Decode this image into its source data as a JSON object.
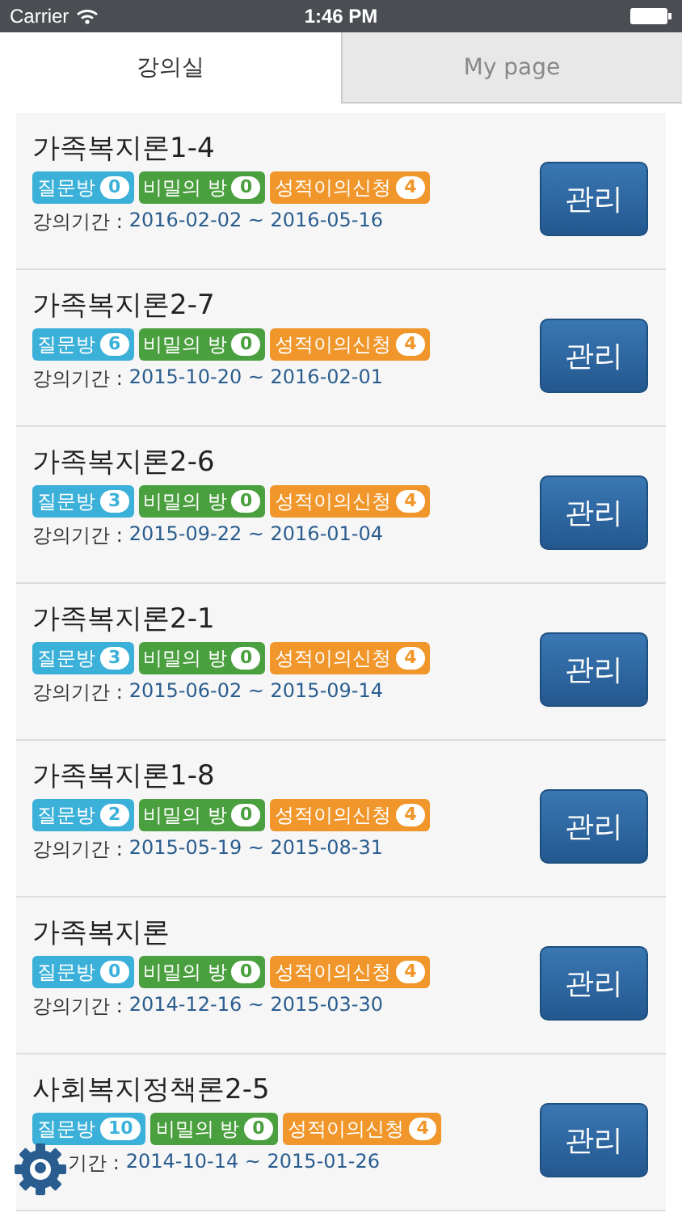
{
  "status_bar": {
    "carrier": "Carrier",
    "time": "1:46 PM"
  },
  "tabs": [
    {
      "label": "강의실",
      "selected": true
    },
    {
      "label": "My page",
      "selected": false
    }
  ],
  "courses": [
    {
      "title": "가족복지론1-4",
      "badges": [
        {
          "label": "질문방",
          "count": "0",
          "color": "#3bb0d9"
        },
        {
          "label": "비밀의 방",
          "count": "0",
          "color": "#4a9f3e"
        },
        {
          "label": "성적이의신청",
          "count": "4",
          "color": "#f0962a"
        }
      ],
      "period_label": "강의기간 :",
      "period": "2016-02-02 ~ 2016-05-16",
      "button": "관리",
      "covered": false
    },
    {
      "title": "가족복지론2-7",
      "badges": [
        {
          "label": "질문방",
          "count": "6",
          "color": "#3bb0d9"
        },
        {
          "label": "비밀의 방",
          "count": "0",
          "color": "#4a9f3e"
        },
        {
          "label": "성적이의신청",
          "count": "4",
          "color": "#f0962a"
        }
      ],
      "period_label": "강의기간 :",
      "period": "2015-10-20 ~ 2016-02-01",
      "button": "관리",
      "covered": false
    },
    {
      "title": "가족복지론2-6",
      "badges": [
        {
          "label": "질문방",
          "count": "3",
          "color": "#3bb0d9"
        },
        {
          "label": "비밀의 방",
          "count": "0",
          "color": "#4a9f3e"
        },
        {
          "label": "성적이의신청",
          "count": "4",
          "color": "#f0962a"
        }
      ],
      "period_label": "강의기간 :",
      "period": "2015-09-22 ~ 2016-01-04",
      "button": "관리",
      "covered": false
    },
    {
      "title": "가족복지론2-1",
      "badges": [
        {
          "label": "질문방",
          "count": "3",
          "color": "#3bb0d9"
        },
        {
          "label": "비밀의 방",
          "count": "0",
          "color": "#4a9f3e"
        },
        {
          "label": "성적이의신청",
          "count": "4",
          "color": "#f0962a"
        }
      ],
      "period_label": "강의기간 :",
      "period": "2015-06-02 ~ 2015-09-14",
      "button": "관리",
      "covered": false
    },
    {
      "title": "가족복지론1-8",
      "badges": [
        {
          "label": "질문방",
          "count": "2",
          "color": "#3bb0d9"
        },
        {
          "label": "비밀의 방",
          "count": "0",
          "color": "#4a9f3e"
        },
        {
          "label": "성적이의신청",
          "count": "4",
          "color": "#f0962a"
        }
      ],
      "period_label": "강의기간 :",
      "period": "2015-05-19 ~ 2015-08-31",
      "button": "관리",
      "covered": false
    },
    {
      "title": "가족복지론",
      "badges": [
        {
          "label": "질문방",
          "count": "0",
          "color": "#3bb0d9"
        },
        {
          "label": "비밀의 방",
          "count": "0",
          "color": "#4a9f3e"
        },
        {
          "label": "성적이의신청",
          "count": "4",
          "color": "#f0962a"
        }
      ],
      "period_label": "강의기간 :",
      "period": "2014-12-16 ~ 2015-03-30",
      "button": "관리",
      "covered": false
    },
    {
      "title": "사회복지정책론2-5",
      "badges": [
        {
          "label": "질문방",
          "count": "10",
          "color": "#3bb0d9"
        },
        {
          "label": "비밀의 방",
          "count": "0",
          "color": "#4a9f3e"
        },
        {
          "label": "성적이의신청",
          "count": "4",
          "color": "#f0962a"
        }
      ],
      "period_label": "기간 :",
      "period": "2014-10-14 ~ 2015-01-26",
      "button": "관리",
      "covered": true
    }
  ]
}
